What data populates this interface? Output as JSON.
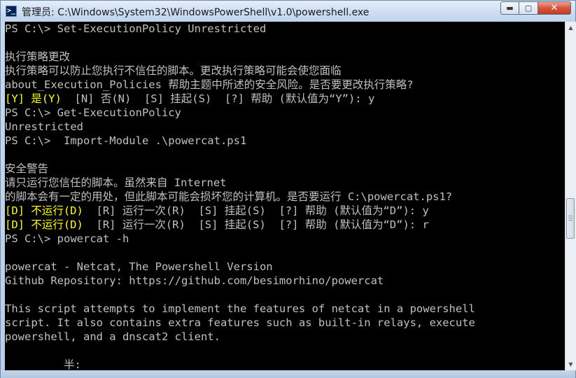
{
  "window": {
    "title": "管理员: C:\\Windows\\System32\\WindowsPowerShell\\v1.0\\powershell.exe",
    "icon_text": ">_",
    "minimize_label": "▬",
    "maximize_label": "▢",
    "close_label": "✕"
  },
  "console": {
    "lines": [
      {
        "text": "PS C:\\> Set-ExecutionPolicy Unrestricted",
        "color": "#c0c0c0"
      },
      {
        "text": "",
        "color": "#c0c0c0"
      },
      {
        "text": "执行策略更改",
        "color": "#c0c0c0"
      },
      {
        "text": "执行策略可以防止您执行不信任的脚本。更改执行策略可能会使您面临",
        "color": "#c0c0c0"
      },
      {
        "text": "about_Execution_Policies 帮助主题中所述的安全风险。是否要更改执行策略?",
        "color": "#c0c0c0"
      },
      {
        "segments": [
          {
            "text": "[Y] 是(Y)",
            "color": "#ffff00"
          },
          {
            "text": "  [N] 否(N)  [S] 挂起(S)  [?] 帮助 (默认值为“Y”): y",
            "color": "#c0c0c0"
          }
        ]
      },
      {
        "text": "PS C:\\> Get-ExecutionPolicy",
        "color": "#c0c0c0"
      },
      {
        "text": "Unrestricted",
        "color": "#c0c0c0"
      },
      {
        "text": "PS C:\\>  Import-Module .\\powercat.ps1",
        "color": "#c0c0c0"
      },
      {
        "text": "",
        "color": "#c0c0c0"
      },
      {
        "text": "安全警告",
        "color": "#c0c0c0"
      },
      {
        "text": "请只运行您信任的脚本。虽然来自 Internet",
        "color": "#c0c0c0"
      },
      {
        "text": "的脚本会有一定的用处，但此脚本可能会损坏您的计算机。是否要运行 C:\\powercat.ps1?",
        "color": "#c0c0c0"
      },
      {
        "segments": [
          {
            "text": "[D] 不运行(D)",
            "color": "#ffff00"
          },
          {
            "text": "  [R] 运行一次(R)  [S] 挂起(S)  [?] 帮助 (默认值为“D”): y",
            "color": "#c0c0c0"
          }
        ]
      },
      {
        "segments": [
          {
            "text": "[D] 不运行(D)",
            "color": "#ffff00"
          },
          {
            "text": "  [R] 运行一次(R)  [S] 挂起(S)  [?] 帮助 (默认值为“D”): r",
            "color": "#c0c0c0"
          }
        ]
      },
      {
        "text": "PS C:\\> powercat -h",
        "color": "#c0c0c0"
      },
      {
        "text": "",
        "color": "#c0c0c0"
      },
      {
        "text": "powercat - Netcat, The Powershell Version",
        "color": "#c0c0c0"
      },
      {
        "text": "Github Repository: https://github.com/besimorhino/powercat",
        "color": "#c0c0c0"
      },
      {
        "text": "",
        "color": "#c0c0c0"
      },
      {
        "text": "This script attempts to implement the features of netcat in a powershell",
        "color": "#c0c0c0"
      },
      {
        "text": "script. It also contains extra features such as built-in relays, execute",
        "color": "#c0c0c0"
      },
      {
        "text": "powershell, and a dnscat2 client.",
        "color": "#c0c0c0"
      },
      {
        "text": "",
        "color": "#c0c0c0"
      },
      {
        "text": "         半:",
        "color": "#c0c0c0"
      }
    ]
  },
  "scrollbar": {
    "up_icon": "▲",
    "down_icon": "▼",
    "position_fraction": 0.58
  }
}
